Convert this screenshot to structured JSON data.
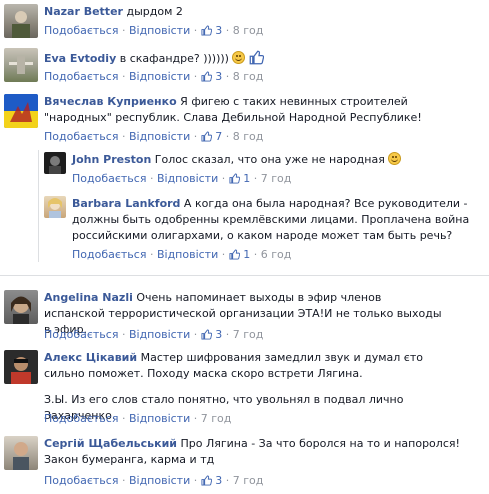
{
  "comments": [
    {
      "author": "Nazar Better",
      "text": " дырдом 2",
      "like": "Подобається",
      "reply": "Відповісти",
      "likes": "3",
      "time": "8 год"
    },
    {
      "author": "Eva Evtodiy",
      "text": " в скафандре? ))))))",
      "like": "Подобається",
      "reply": "Відповісти",
      "likes": "3",
      "time": "8 год"
    },
    {
      "author": "Вячеслав Куприенко",
      "text": " Я фигею с таких невинных строителей \"народных\" республик. Слава Дебильной Народной Республике!",
      "like": "Подобається",
      "reply": "Відповісти",
      "likes": "7",
      "time": "8 год"
    },
    {
      "author": "John Preston",
      "text": " Голос сказал, что она уже не народная",
      "like": "Подобається",
      "reply": "Відповісти",
      "likes": "1",
      "time": "7 год"
    },
    {
      "author": "Barbara Lankford",
      "text": " А когда она была народная? Все руководители - должны быть одобренны кремлёвскими лицами. Проплачена война российскими олигархами, о каком народе может там быть речь?",
      "like": "Подобається",
      "reply": "Відповісти",
      "likes": "1",
      "time": "6 год"
    },
    {
      "author": "Angelina Nazli",
      "text": " Очень напоминает выходы в эфир членов испанской террористической организации ЭТА!И не только выходы в эфир.",
      "like": "Подобається",
      "reply": "Відповісти",
      "likes": "3",
      "time": "7 год"
    },
    {
      "author": "Алекс Цікавий",
      "text": " Мастер шифрования замедлил звук и думал єто сильно поможет. Походу маска скоро встрети Лягина.",
      "text2": "З.Ы. Из его слов стало понятно, что увольнял в подвал лично Захарченко.",
      "like": "Подобається",
      "reply": "Відповісти",
      "likes": "",
      "time": "7 год"
    },
    {
      "author": "Сергій Щабельський",
      "text": " Про Лягина - За что боролся на то и напоролся! Закон бумеранга, карма и тд",
      "like": "Подобається",
      "reply": "Відповісти",
      "likes": "3",
      "time": "7 год"
    }
  ],
  "colors": {
    "link": "#3b5998",
    "action": "#4267b2",
    "muted": "#90949c",
    "text": "#141823"
  }
}
